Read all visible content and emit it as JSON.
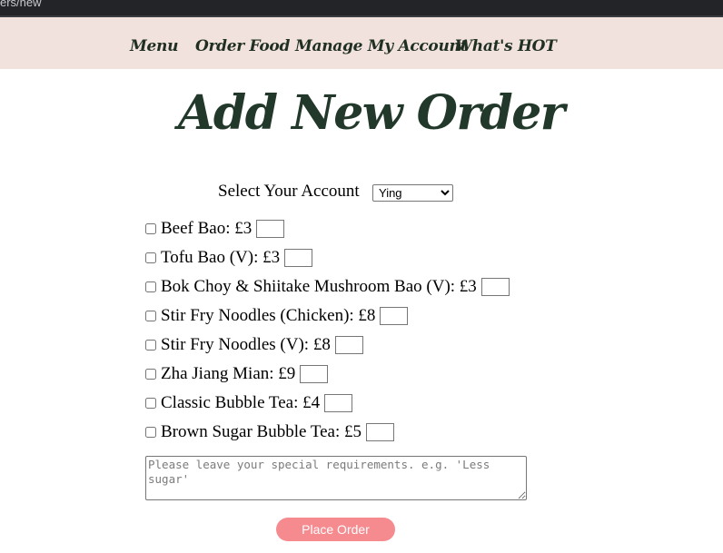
{
  "browser": {
    "url_fragment": "ers/new"
  },
  "nav": {
    "items": [
      {
        "label": "Menu"
      },
      {
        "label": "Order Food"
      },
      {
        "label": "Manage My Account"
      },
      {
        "label": "What's HOT"
      }
    ]
  },
  "page": {
    "title": "Add New Order"
  },
  "account": {
    "label": "Select Your Account",
    "selected": "Ying"
  },
  "items": [
    {
      "label": "Beef Bao: £3"
    },
    {
      "label": "Tofu Bao (V): £3"
    },
    {
      "label": "Bok Choy & Shiitake Mushroom Bao (V): £3"
    },
    {
      "label": "Stir Fry Noodles (Chicken): £8"
    },
    {
      "label": "Stir Fry Noodles (V): £8"
    },
    {
      "label": "Zha Jiang Mian: £9"
    },
    {
      "label": "Classic Bubble Tea: £4"
    },
    {
      "label": "Brown Sugar Bubble Tea: £5"
    }
  ],
  "notes": {
    "placeholder": "Please leave your special requirements. e.g. 'Less sugar'"
  },
  "submit": {
    "label": "Place Order"
  },
  "colors": {
    "nav_background": "#f2e2dd",
    "title_color": "#22382a",
    "button_background": "#f58a8f"
  }
}
